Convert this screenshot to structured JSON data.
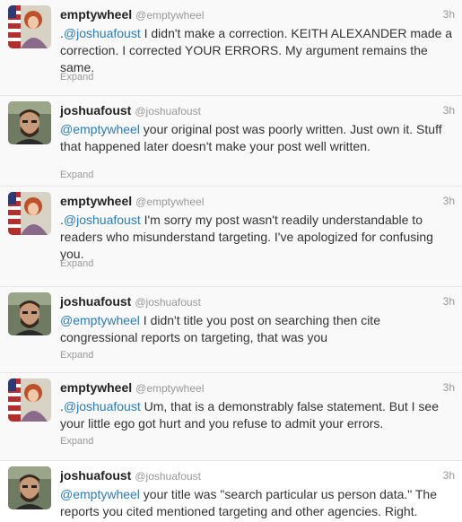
{
  "tweets": [
    {
      "name": "emptywheel",
      "handle": "@emptywheel",
      "time": "3h",
      "prefix": ".",
      "mention": "@joshuafoust",
      "body": " I didn't make a correction. KEITH ALEXANDER made a correction. I corrected YOUR ERRORS. My argument remains the same.",
      "expand_label": "Expand"
    },
    {
      "name": "joshuafoust",
      "handle": "@joshuafoust",
      "time": "3h",
      "prefix": "",
      "mention": "@emptywheel",
      "body": " your original post was poorly written. Just own it. Stuff that happened later doesn't make your post well written.",
      "expand_label": "Expand"
    },
    {
      "name": "emptywheel",
      "handle": "@emptywheel",
      "time": "3h",
      "prefix": ".",
      "mention": "@joshuafoust",
      "body": " I'm sorry my post wasn't readily understandable to readers who misunderstand targeting. I've apologized for confusing you.",
      "expand_label": "Expand"
    },
    {
      "name": "joshuafoust",
      "handle": "@joshuafoust",
      "time": "3h",
      "prefix": "",
      "mention": "@emptywheel",
      "body": " I didn't title you post on searching then cite congressional reports on targeting, that was you",
      "expand_label": "Expand"
    },
    {
      "name": "emptywheel",
      "handle": "@emptywheel",
      "time": "3h",
      "prefix": ".",
      "mention": "@joshuafoust",
      "body": " Um, that is a demonstrably false statement. But I see your little ego got hurt and you refuse to admit your errors.",
      "expand_label": "Expand"
    },
    {
      "name": "joshuafoust",
      "handle": "@joshuafoust",
      "time": "3h",
      "prefix": "",
      "mention": "@emptywheel",
      "body": " your title was \"search particular us person data.\" The reports you cited mentioned targeting and other agencies. Right.",
      "expand_label": ""
    }
  ],
  "colors": {
    "mention": "#2b7bb9",
    "name": "#222222",
    "meta": "#999999",
    "text": "#333333"
  }
}
